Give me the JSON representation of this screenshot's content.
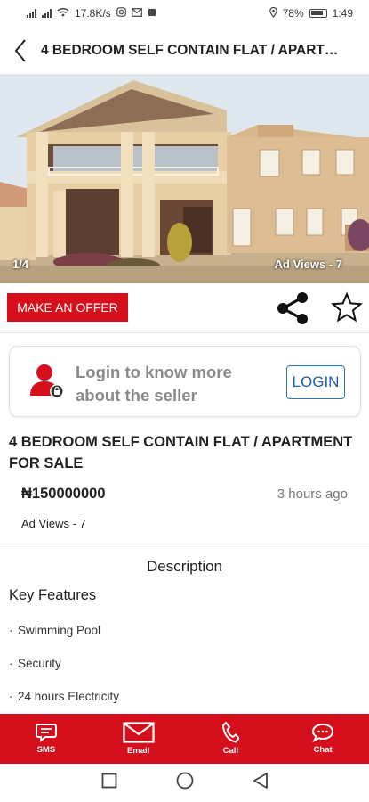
{
  "status_bar": {
    "network_speed": "17.8K/s",
    "battery": "78%",
    "time": "1:49"
  },
  "header": {
    "title": "4 BEDROOM SELF CONTAIN FLAT / APARTMENT FOR SALE"
  },
  "gallery": {
    "counter": "1/4",
    "overlay_text": "Ad Views - 7"
  },
  "actions": {
    "offer_label": "MAKE AN OFFER"
  },
  "login_card": {
    "message": "Login to know more about the seller",
    "button_label": "LOGIN"
  },
  "listing": {
    "title": "4 BEDROOM SELF CONTAIN FLAT / APARTMENT FOR SALE",
    "price": "₦150000000",
    "posted": "3 hours ago",
    "views": "Ad Views - 7",
    "description_heading": "Description",
    "key_features_heading": "Key Features",
    "features": [
      "Swimming Pool",
      "Security",
      "24 hours Electricity"
    ]
  },
  "bottom_nav": [
    {
      "label": "SMS",
      "icon": "sms-icon"
    },
    {
      "label": "Email",
      "icon": "email-icon"
    },
    {
      "label": "Call",
      "icon": "phone-icon"
    },
    {
      "label": "Chat",
      "icon": "chat-icon"
    }
  ],
  "colors": {
    "brand_red": "#d50f1c",
    "login_blue": "#2b77c0"
  }
}
